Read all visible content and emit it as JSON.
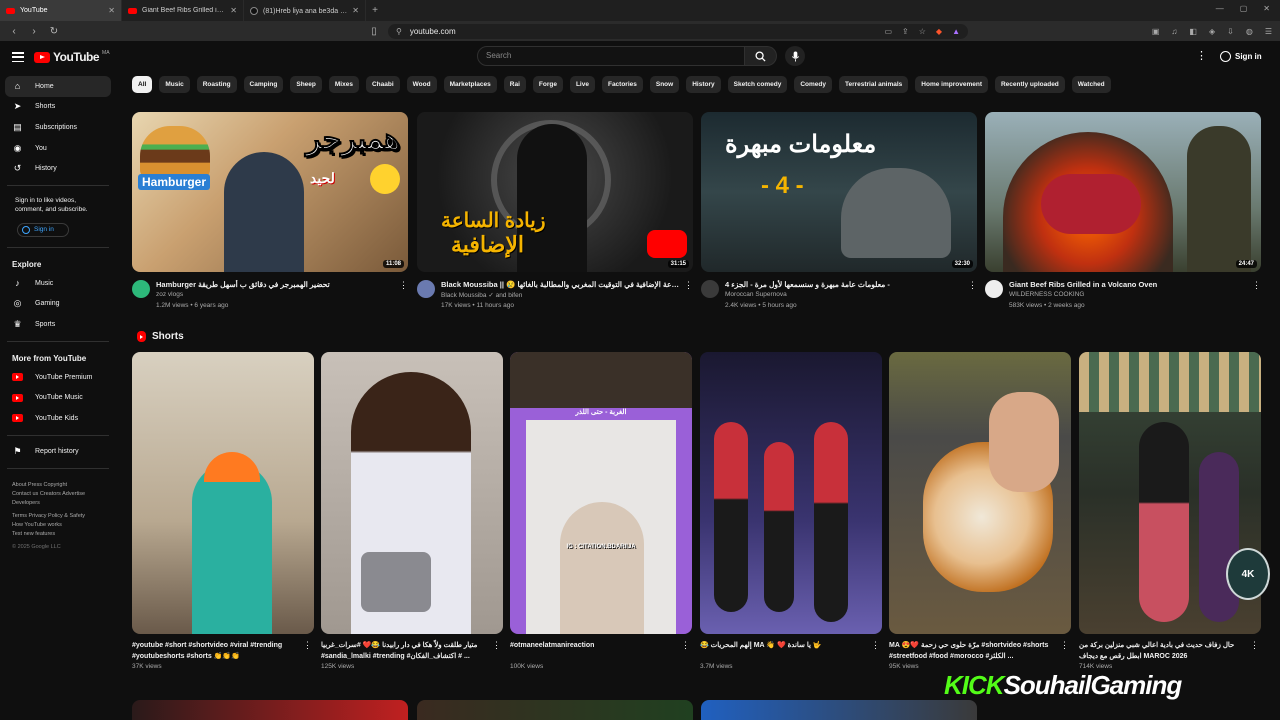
{
  "browser": {
    "tabs": [
      {
        "label": "YouTube",
        "icon": "youtube-icon",
        "active": true
      },
      {
        "label": "Giant Beef Ribs Grilled in a Volcano",
        "icon": "youtube-icon",
        "active": false
      },
      {
        "label": "(81)Hreb liya ana be3da 😂😭 #nil",
        "icon": "tiktok-icon",
        "active": false
      }
    ],
    "url": "youtube.com"
  },
  "masthead": {
    "logo_text": "YouTube",
    "country_code": "MA",
    "search_placeholder": "Search",
    "signin_label": "Sign in"
  },
  "sidebar": {
    "main": [
      {
        "label": "Home",
        "icon": "home-icon",
        "active": true
      },
      {
        "label": "Shorts",
        "icon": "shorts-icon"
      },
      {
        "label": "Subscriptions",
        "icon": "subscriptions-icon"
      }
    ],
    "you": [
      {
        "label": "You",
        "icon": "you-icon"
      },
      {
        "label": "History",
        "icon": "history-icon"
      }
    ],
    "signin_promo": "Sign in to like videos, comment, and subscribe.",
    "signin_button": "Sign in",
    "explore_heading": "Explore",
    "explore": [
      {
        "label": "Music",
        "icon": "music-icon"
      },
      {
        "label": "Gaming",
        "icon": "gaming-icon"
      },
      {
        "label": "Sports",
        "icon": "trophy-icon"
      }
    ],
    "more_heading": "More from YouTube",
    "more": [
      {
        "label": "YouTube Premium"
      },
      {
        "label": "YouTube Music"
      },
      {
        "label": "YouTube Kids"
      }
    ],
    "report": "Report history",
    "footer1": "About  Press  Copyright",
    "footer2": "Contact us  Creators  Advertise",
    "footer3": "Developers",
    "footer4": "Terms  Privacy  Policy & Safety",
    "footer5": "How YouTube works",
    "footer6": "Test new features",
    "copyright": "© 2025 Google LLC"
  },
  "chips": [
    "All",
    "Music",
    "Roasting",
    "Camping",
    "Sheep",
    "Mixes",
    "Chaabi",
    "Wood",
    "Marketplaces",
    "Rai",
    "Forge",
    "Live",
    "Factories",
    "Snow",
    "History",
    "Sketch comedy",
    "Comedy",
    "Terrestrial animals",
    "Home improvement",
    "Recently uploaded",
    "Watched"
  ],
  "videos": [
    {
      "title": "Hamburger تحضير الهمبرجر في دقائق ب أسهل طريقة",
      "channel": "zoz vlogs",
      "stats": "1.2M views • 6 years ago",
      "duration": "11:08",
      "thumb_text": "همبرجر",
      "thumb_sub": "Hamburger",
      "thumb_sub2": "لحيد"
    },
    {
      "title": "Black Moussiba || 😢 زيادة الساعة الإضافية في التوقيت المغربي والمطالبة بالغائها",
      "channel": "Black Moussiba ✓ and bifen",
      "stats": "17K views • 11 hours ago",
      "duration": "31:15",
      "thumb_text": "زيادة الساعة",
      "thumb_sub": "الإضافية"
    },
    {
      "title": "معلومات عامة مبهرة و سنسمعها لأول مرة - الجزء 4 -",
      "channel": "Moroccan Supernova",
      "stats": "2.4K views • 5 hours ago",
      "duration": "32:30",
      "thumb_text": "معلومات مبهرة",
      "thumb_sub": "- 4 -"
    },
    {
      "title": "Giant Beef Ribs Grilled in a Volcano Oven",
      "channel": "WILDERNESS COOKING",
      "stats": "583K views • 2 weeks ago",
      "duration": "24:47"
    }
  ],
  "shorts": {
    "heading": "Shorts",
    "items": [
      {
        "title": "#youtube #short #shortvideo #viral #trending #youtubeshorts #shorts 👏👏👏",
        "views": "37K views"
      },
      {
        "title": "متيار طلقت ولاّ هكا في دار رابيدنا 😂❤️ #سرات_غربيا #sandia_lmalki #trending #اكتشاف_الفكان # ...",
        "views": "125K views"
      },
      {
        "title": "#otmaneelatmanireaction",
        "views": "100K views",
        "overlay1": "الغربة - حتى اللذر",
        "overlay2": "IG : CITATION.BDARIIJA"
      },
      {
        "title": "😂 إلهم المحريات MA 👋 ❤️ يا ساندة 🤟",
        "views": "3.7M views"
      },
      {
        "title": "MA 😍❤️ مرّة حلوى حي زحمة #shortvideo #shorts #streetfood #food #morocco #الكلثز ...",
        "views": "95K views"
      },
      {
        "title": "حال زفاف حديث في بادية اعالي شبي منزلين بركة من ابطل رقص مع ديجاف MAROC 2026",
        "views": "714K views"
      }
    ]
  },
  "watermark": {
    "part1": "KICK",
    "part2": "SouhailGaming",
    "badge": "4K"
  },
  "colors": {
    "bg": "#0f0f0f",
    "accent_red": "#ff0000",
    "link_blue": "#3ea6ff",
    "kick_green": "#53fc18"
  }
}
